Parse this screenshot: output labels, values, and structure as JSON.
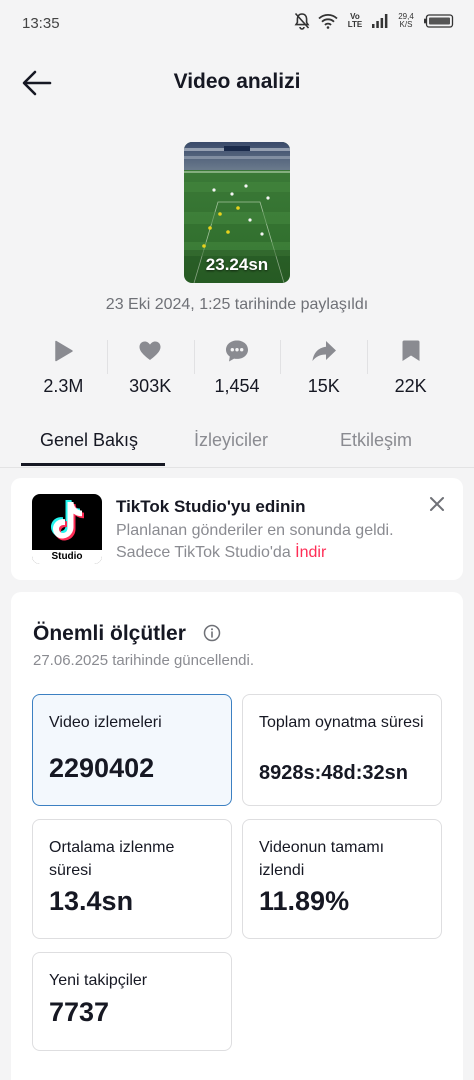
{
  "status_bar": {
    "time": "13:35",
    "network": "Vo LTE",
    "speed_value": "29,4",
    "speed_unit": "K/S",
    "icons": [
      "mute-bell-icon",
      "wifi-icon",
      "signal-icon",
      "battery-icon"
    ]
  },
  "header": {
    "title": "Video analizi",
    "back_icon": "arrow-left-icon"
  },
  "video": {
    "duration": "23.24sn",
    "posted": "23 Eki 2024, 1:25 tarihinde paylaşıldı"
  },
  "stats": [
    {
      "icon": "play-icon",
      "value": "2.3M"
    },
    {
      "icon": "heart-icon",
      "value": "303K"
    },
    {
      "icon": "comment-icon",
      "value": "1,454"
    },
    {
      "icon": "share-icon",
      "value": "15K"
    },
    {
      "icon": "bookmark-icon",
      "value": "22K"
    }
  ],
  "tabs": [
    {
      "label": "Genel Bakış",
      "active": true
    },
    {
      "label": "İzleyiciler",
      "active": false
    },
    {
      "label": "Etkileşim",
      "active": false
    }
  ],
  "promo": {
    "logo_label": "Studio",
    "title": "TikTok Studio'yu edinin",
    "description": "Planlanan gönderiler en sonunda geldi. Sadece TikTok Studio'da",
    "link": "İndir"
  },
  "metrics": {
    "title": "Önemli ölçütler",
    "updated": "27.06.2025 tarihinde güncellendi.",
    "items": [
      {
        "label": "Video izlemeleri",
        "value": "2290402"
      },
      {
        "label": "Toplam oynatma süresi",
        "value": "8928s:48d:32sn"
      },
      {
        "label": "Ortalama izlenme süresi",
        "value": "13.4sn"
      },
      {
        "label": "Videonun tamamı izlendi",
        "value": "11.89%"
      },
      {
        "label": "Yeni takipçiler",
        "value": "7737"
      }
    ]
  },
  "colors": {
    "accent_link": "#fe2c55",
    "selected_border": "#3c80c2",
    "selected_bg": "#f3f8fd",
    "icon_gray": "#8a8b91"
  }
}
